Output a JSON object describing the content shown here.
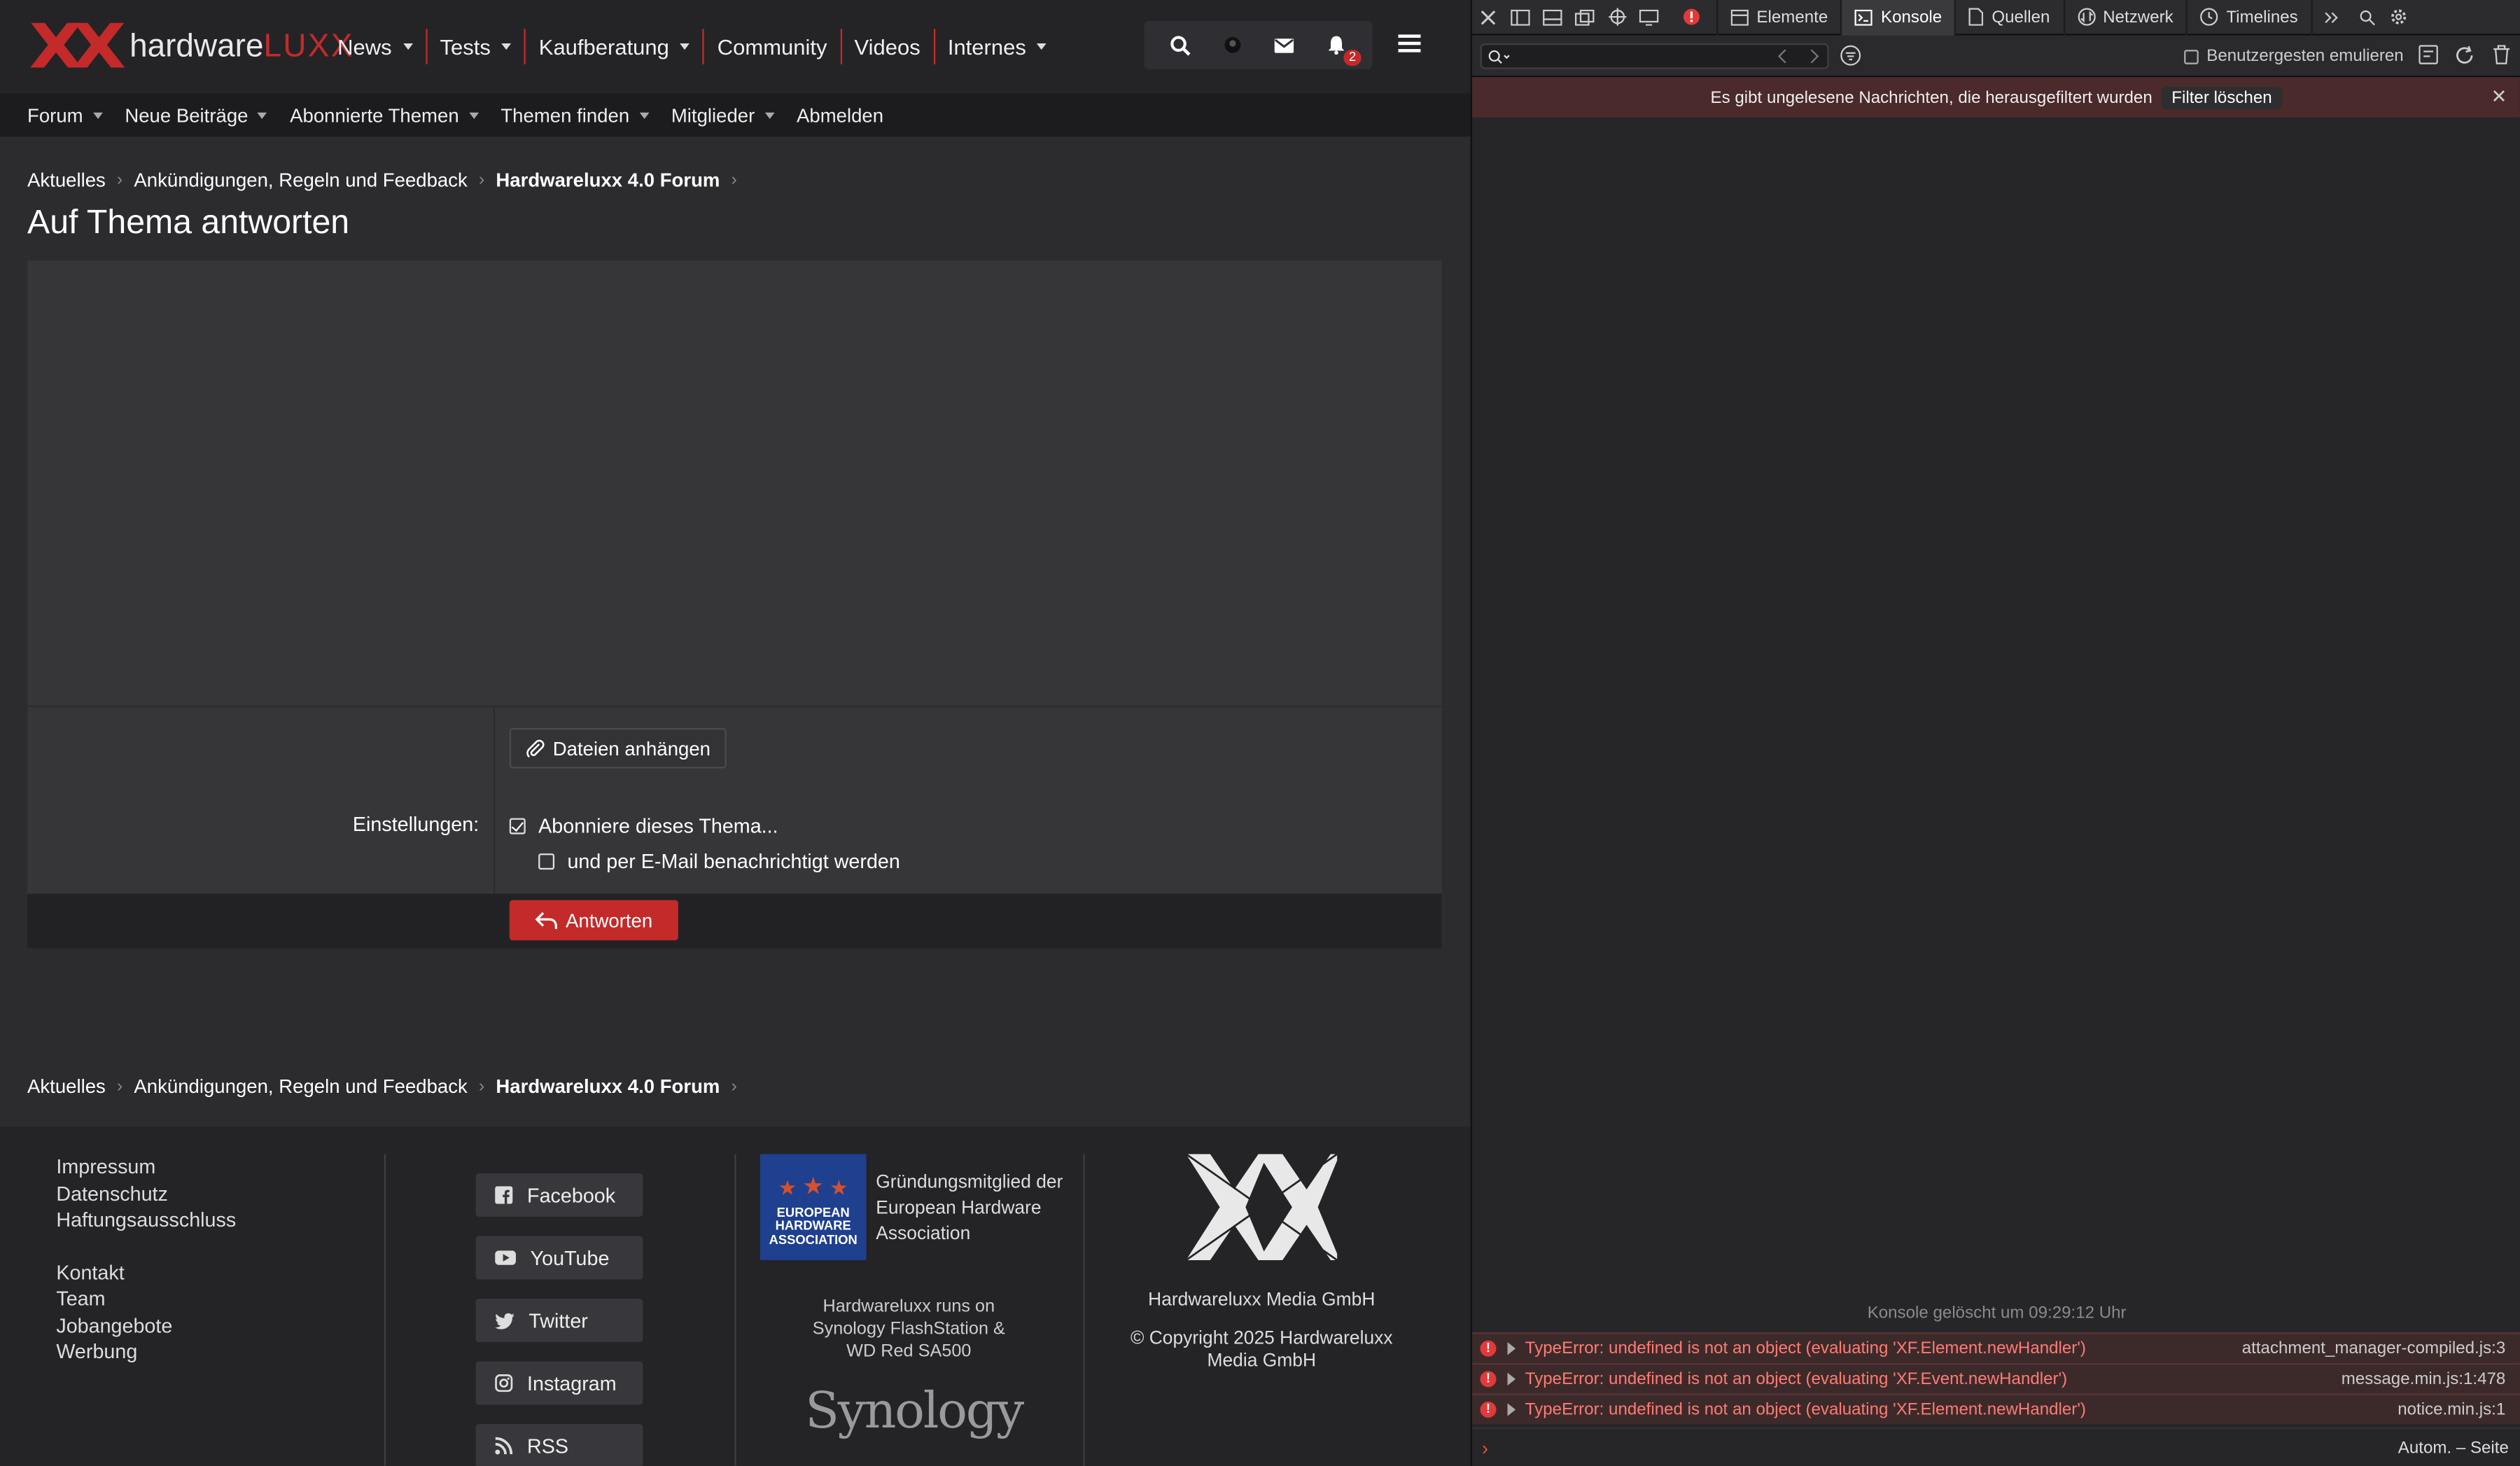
{
  "site": {
    "logo": {
      "mark": "XX",
      "text_main": "hardware",
      "text_accent": "LUXX"
    },
    "nav": [
      {
        "label": "News",
        "dropdown": true
      },
      {
        "label": "Tests",
        "dropdown": true
      },
      {
        "label": "Kaufberatung",
        "dropdown": true
      },
      {
        "label": "Community",
        "dropdown": false
      },
      {
        "label": "Videos",
        "dropdown": false
      },
      {
        "label": "Internes",
        "dropdown": true
      }
    ],
    "notification_count": "2",
    "subnav": [
      {
        "label": "Forum",
        "dropdown": true
      },
      {
        "label": "Neue Beiträge",
        "dropdown": true
      },
      {
        "label": "Abonnierte Themen",
        "dropdown": true
      },
      {
        "label": "Themen finden",
        "dropdown": true
      },
      {
        "label": "Mitglieder",
        "dropdown": true
      },
      {
        "label": "Abmelden",
        "dropdown": false
      }
    ],
    "breadcrumb": [
      "Aktuelles",
      "Ankündigungen, Regeln und Feedback",
      "Hardwareluxx 4.0 Forum"
    ],
    "page_title": "Auf Thema antworten",
    "form": {
      "attach_label": "Dateien anhängen",
      "settings_label": "Einstellungen:",
      "subscribe_label": "Abonniere dieses Thema...",
      "subscribe_checked": true,
      "email_label": "und per E-Mail benachrichtigt werden",
      "email_checked": false,
      "reply_label": "Antworten"
    },
    "footer": {
      "links_group1": [
        "Impressum",
        "Datenschutz",
        "Haftungsausschluss"
      ],
      "links_group2": [
        "Kontakt",
        "Team",
        "Jobangebote",
        "Werbung"
      ],
      "social": [
        "Facebook",
        "YouTube",
        "Twitter",
        "Instagram",
        "RSS"
      ],
      "eha_logo_lines": [
        "EUROPEAN",
        "HARDWARE",
        "ASSOCIATION"
      ],
      "eha_text": "Gründungsmitglied der European Hardware Association",
      "synology_text": "Hardwareluxx runs on Synology FlashStation & WD Red SA500",
      "synology_logo": "Synology",
      "company": "Hardwareluxx Media GmbH",
      "copyright": "© Copyright 2025 Hardwareluxx Media GmbH"
    },
    "colors": {
      "accent": "#c42a2a",
      "bg": "#2c2c2f",
      "header": "#242427"
    }
  },
  "devtools": {
    "tabs": [
      "Elemente",
      "Konsole",
      "Quellen",
      "Netzwerk",
      "Timelines"
    ],
    "active_tab": "Konsole",
    "emulate_label": "Benutzergesten emulieren",
    "banner_text": "Es gibt ungelesene Nachrichten, die herausgefiltert wurden",
    "banner_button": "Filter löschen",
    "cleared_text": "Konsole gelöscht um 09:29:12 Uhr",
    "errors": [
      {
        "message": "TypeError: undefined is not an object (evaluating 'XF.Element.newHandler')",
        "source": "attachment_manager-compiled.js:3"
      },
      {
        "message": "TypeError: undefined is not an object (evaluating 'XF.Event.newHandler')",
        "source": "message.min.js:1:478"
      },
      {
        "message": "TypeError: undefined is not an object (evaluating 'XF.Element.newHandler')",
        "source": "notice.min.js:1"
      }
    ],
    "autom_label": "Autom. – Seite"
  }
}
